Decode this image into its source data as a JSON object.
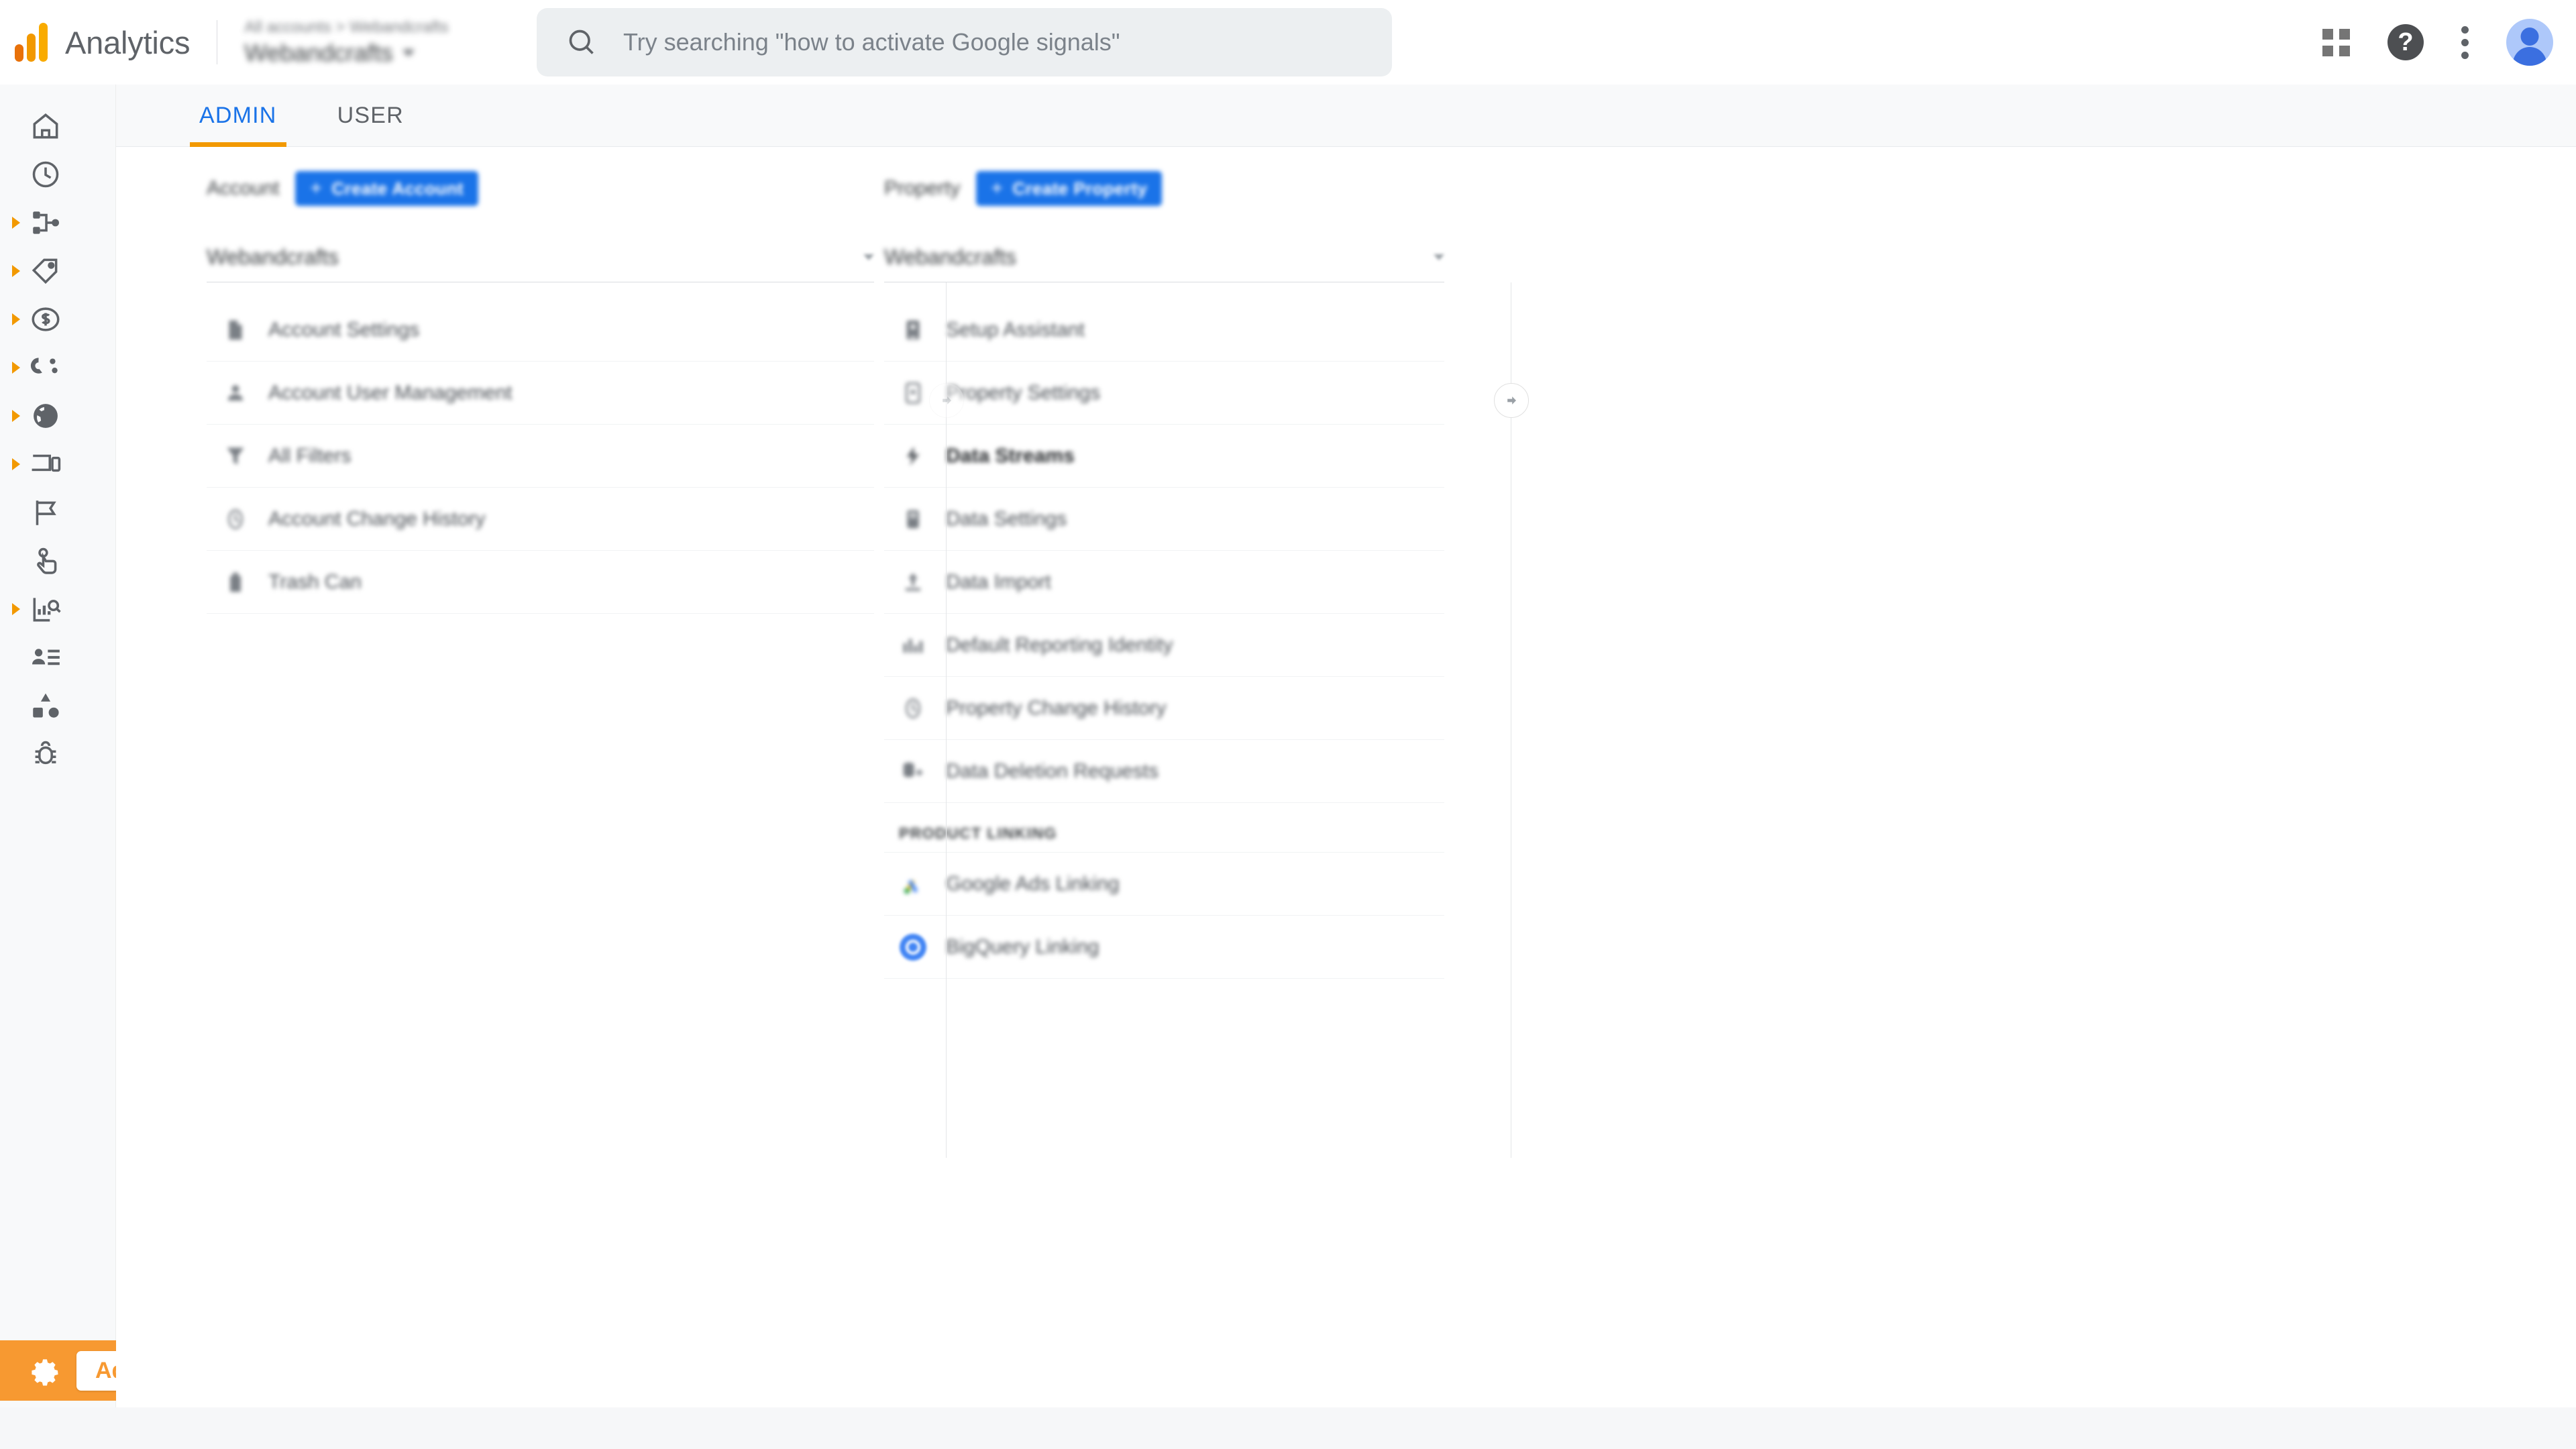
{
  "app": {
    "brand": "Analytics",
    "logo_icon": "analytics-logo-icon"
  },
  "breadcrumb": {
    "path": "All accounts > Webandcrafts",
    "current": "Webandcrafts",
    "caret_icon": "chevron-down-icon"
  },
  "search": {
    "placeholder": "Try searching \"how to activate Google signals\"",
    "value": "",
    "icon": "search-icon"
  },
  "top_actions": {
    "apps_icon": "apps-grid-icon",
    "help_icon": "help-question-icon",
    "help_glyph": "?",
    "more_icon": "more-vert-icon",
    "avatar_icon": "user-avatar-icon"
  },
  "rail": {
    "items": [
      {
        "name": "home",
        "icon": "home-icon",
        "expandable": false
      },
      {
        "name": "realtime",
        "icon": "clock-icon",
        "expandable": false
      },
      {
        "name": "life-cycle",
        "icon": "share-nodes-icon",
        "expandable": true
      },
      {
        "name": "acquisition",
        "icon": "tag-icon",
        "expandable": true
      },
      {
        "name": "monetization",
        "icon": "dollar-circle-icon",
        "expandable": true
      },
      {
        "name": "retention",
        "icon": "magnet-icon",
        "expandable": true
      },
      {
        "name": "demographics",
        "icon": "globe-icon",
        "expandable": true
      },
      {
        "name": "tech",
        "icon": "devices-icon",
        "expandable": true
      },
      {
        "name": "events",
        "icon": "flag-icon",
        "expandable": false
      },
      {
        "name": "conversions",
        "icon": "touch-icon",
        "expandable": false
      },
      {
        "name": "explore",
        "icon": "chart-search-icon",
        "expandable": true
      },
      {
        "name": "audiences",
        "icon": "person-list-icon",
        "expandable": false
      },
      {
        "name": "library",
        "icon": "shapes-icon",
        "expandable": false
      },
      {
        "name": "debug-view",
        "icon": "bug-icon",
        "expandable": false
      }
    ],
    "admin": {
      "label": "Admin",
      "icon": "gear-icon"
    }
  },
  "tabs": [
    {
      "label": "ADMIN",
      "active": true
    },
    {
      "label": "USER",
      "active": false
    }
  ],
  "account_column": {
    "label": "Account",
    "create_button": {
      "label": "Create Account",
      "plus": "+"
    },
    "selector": {
      "value": "Webandcrafts",
      "caret_icon": "chevron-down-icon"
    },
    "items": [
      {
        "label": "Account Settings",
        "icon": "document-settings-icon"
      },
      {
        "label": "Account User Management",
        "icon": "people-icon"
      },
      {
        "label": "All Filters",
        "icon": "filter-icon"
      },
      {
        "label": "Account Change History",
        "icon": "history-clock-icon"
      },
      {
        "label": "Trash Can",
        "icon": "trash-icon"
      }
    ]
  },
  "property_column": {
    "label": "Property",
    "create_button": {
      "label": "Create Property",
      "plus": "+"
    },
    "selector": {
      "value": "Webandcrafts",
      "caret_icon": "chevron-down-icon"
    },
    "items": [
      {
        "label": "Setup Assistant",
        "icon": "setup-assistant-icon",
        "selected": false
      },
      {
        "label": "Property Settings",
        "icon": "property-settings-icon",
        "selected": false
      },
      {
        "label": "Data Streams",
        "icon": "data-streams-icon",
        "selected": true
      },
      {
        "label": "Data Settings",
        "icon": "data-settings-icon",
        "selected": false
      },
      {
        "label": "Data Import",
        "icon": "data-import-icon",
        "selected": false
      },
      {
        "label": "Default Reporting Identity",
        "icon": "reporting-identity-icon",
        "selected": false
      },
      {
        "label": "Property Change History",
        "icon": "history-clock-icon",
        "selected": false
      },
      {
        "label": "Data Deletion Requests",
        "icon": "data-deletion-icon",
        "selected": false
      }
    ],
    "section_title": "PRODUCT LINKING",
    "linking_items": [
      {
        "label": "Google Ads Linking",
        "icon": "google-ads-logo-icon"
      },
      {
        "label": "BigQuery Linking",
        "icon": "bigquery-logo-icon"
      }
    ]
  },
  "dividers": {
    "collapse_icon": "arrow-right-circle-icon"
  },
  "colors": {
    "accent_blue": "#1a73e8",
    "accent_orange": "#f29900",
    "admin_orange": "#f79931",
    "text_primary": "#3c4043",
    "text_secondary": "#5f6368"
  }
}
